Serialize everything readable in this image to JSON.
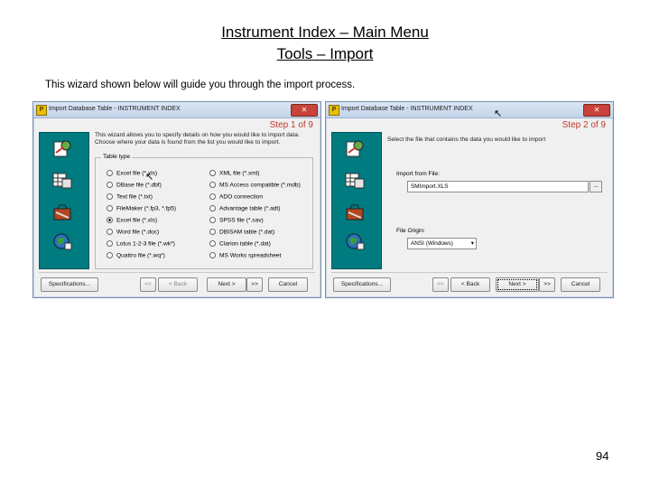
{
  "slide": {
    "title_line1": "Instrument Index – Main Menu",
    "title_line2": "Tools – Import",
    "intro": "This wizard shown below will guide you through the import process.",
    "page_number": "94"
  },
  "wizard1": {
    "window_title": "Import Database Table - INSTRUMENT INDEX",
    "step": "Step 1 of 9",
    "description": "This wizard allows you to specify details on how you would like to import data. Choose where your data is found from the list you would like to import.",
    "group_label": "Table type",
    "options_left": [
      "Excel file (*.xls)",
      "DBase file (*.dbf)",
      "Text file (*.txt)",
      "FileMaker (*.fp3, *.fp5)",
      "Excel file (*.xls)",
      "Word file (*.doc)",
      "Lotus 1-2-3 file (*.wk*)",
      "Quattro file (*.wq*)"
    ],
    "options_right": [
      "XML file (*.xml)",
      "MS Access compatible (*.mdb)",
      "ADO connection",
      "Advantage table (*.adt)",
      "SPSS file (*.sav)",
      "DBISAM table (*.dat)",
      "Clarion table (*.dat)",
      "MS Works spreadsheet"
    ],
    "selected_option": "Excel file (*.xls)",
    "buttons": {
      "specifications": "Specifications...",
      "first": "<<",
      "back": "< Back",
      "next": "Next >",
      "last": ">>",
      "cancel": "Cancel"
    }
  },
  "wizard2": {
    "window_title": "Import Database Table - INSTRUMENT INDEX",
    "step": "Step 2 of 9",
    "description": "Select the file that contains the data you would like to import",
    "import_from_file_label": "Import from File:",
    "import_from_file_value": "SMImport.XLS",
    "browse_label": "...",
    "file_origin_label": "File Origin:",
    "file_origin_value": "ANSI (Windows)",
    "buttons": {
      "specifications": "Specifications...",
      "first": "<<",
      "back": "< Back",
      "next": "Next >",
      "last": ">>",
      "cancel": "Cancel"
    }
  },
  "colors": {
    "sidebar": "#007b80",
    "step_text": "#c0392b"
  }
}
